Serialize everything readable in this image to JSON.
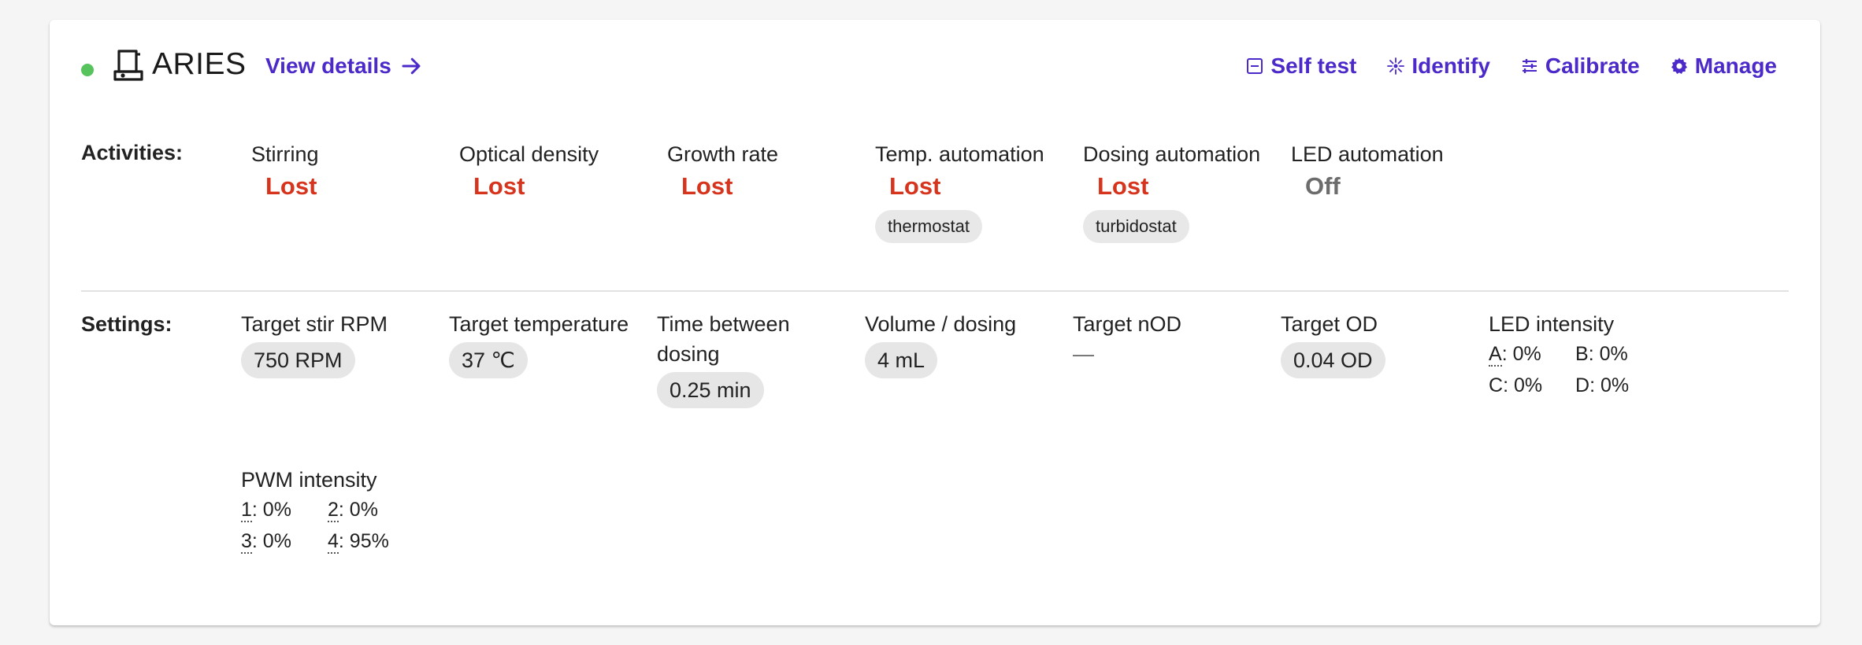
{
  "unit": {
    "name": "ARIES",
    "status_color": "#56c35c",
    "icon": "bioreactor-icon"
  },
  "header": {
    "view_details": "View details",
    "actions": [
      {
        "label": "Self test",
        "icon": "self-test-icon"
      },
      {
        "label": "Identify",
        "icon": "identify-icon"
      },
      {
        "label": "Calibrate",
        "icon": "calibrate-icon"
      },
      {
        "label": "Manage",
        "icon": "gear-icon"
      }
    ]
  },
  "colors": {
    "accent": "#4b2ac9",
    "lost": "#d6341d",
    "off": "#6c6c6c"
  },
  "activities": {
    "label": "Activities:",
    "items": [
      {
        "title": "Stirring",
        "state": "Lost"
      },
      {
        "title": "Optical density",
        "state": "Lost"
      },
      {
        "title": "Growth rate",
        "state": "Lost"
      },
      {
        "title": "Temp. automation",
        "state": "Lost",
        "chip": "thermostat"
      },
      {
        "title": "Dosing automation",
        "state": "Lost",
        "chip": "turbidostat"
      },
      {
        "title": "LED automation",
        "state": "Off"
      }
    ]
  },
  "settings": {
    "label": "Settings:",
    "target_stir_rpm": {
      "title": "Target stir RPM",
      "value": "750 RPM"
    },
    "target_temperature": {
      "title": "Target temperature",
      "value": "37 ℃"
    },
    "time_between_dosing": {
      "title_line1": "Time between",
      "title_line2": "dosing",
      "value": "0.25 min"
    },
    "volume_dosing": {
      "title": "Volume / dosing",
      "value": "4 mL"
    },
    "target_nod": {
      "title": "Target nOD",
      "value": "—"
    },
    "target_od": {
      "title": "Target OD",
      "value": "0.04 OD"
    },
    "led_intensity": {
      "title": "LED intensity",
      "channels": [
        {
          "key": "A",
          "value": ": 0%"
        },
        {
          "key": "B",
          "value": ": 0%"
        },
        {
          "key": "C",
          "value": ": 0%"
        },
        {
          "key": "D",
          "value": ": 0%"
        }
      ]
    },
    "pwm_intensity": {
      "title": "PWM intensity",
      "channels": [
        {
          "key": "1",
          "value": ": 0%"
        },
        {
          "key": "2",
          "value": ": 0%"
        },
        {
          "key": "3",
          "value": ": 0%"
        },
        {
          "key": "4",
          "value": ": 95%"
        }
      ]
    }
  }
}
